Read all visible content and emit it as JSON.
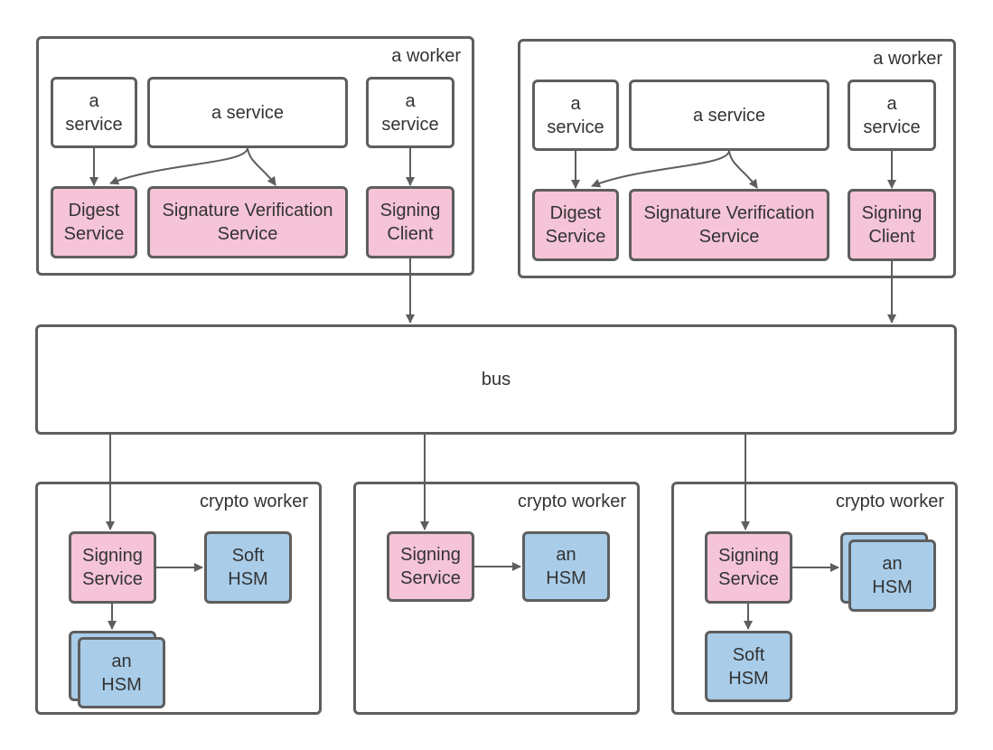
{
  "colors": {
    "stroke": "#5e5e5e",
    "pink": "#f5c4d8",
    "blue": "#a9cde9"
  },
  "workers": [
    {
      "label": "a worker",
      "services": [
        "a service",
        "a service",
        "a service"
      ],
      "components": [
        "Digest Service",
        "Signature Verification Service",
        "Signing Client"
      ]
    },
    {
      "label": "a worker",
      "services": [
        "a service",
        "a service",
        "a service"
      ],
      "components": [
        "Digest Service",
        "Signature Verification Service",
        "Signing Client"
      ]
    }
  ],
  "bus": {
    "label": "bus"
  },
  "crypto_workers": [
    {
      "label": "crypto worker",
      "signing": "Signing Service",
      "soft_hsm": "Soft HSM",
      "hsm": "an HSM"
    },
    {
      "label": "crypto worker",
      "signing": "Signing Service",
      "hsm": "an HSM"
    },
    {
      "label": "crypto worker",
      "signing": "Signing Service",
      "soft_hsm": "Soft HSM",
      "hsm": "an HSM"
    }
  ]
}
